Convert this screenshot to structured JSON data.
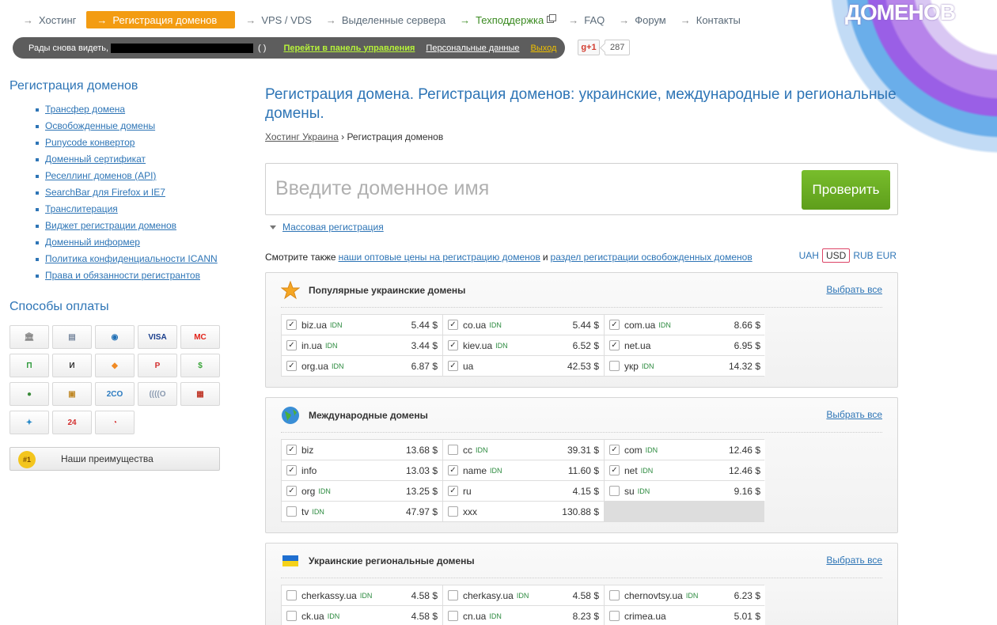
{
  "nav": [
    {
      "label": "Хостинг",
      "style": ""
    },
    {
      "label": "Регистрация доменов",
      "style": "active"
    },
    {
      "label": "VPS / VDS",
      "style": ""
    },
    {
      "label": "Выделенные сервера",
      "style": ""
    },
    {
      "label": "Техподдержка",
      "style": "green"
    },
    {
      "label": "FAQ",
      "style": ""
    },
    {
      "label": "Форум",
      "style": ""
    },
    {
      "label": "Контакты",
      "style": ""
    }
  ],
  "nav_arrow": "→",
  "brand": "ДОМЕНОВ",
  "greeting": {
    "text": "Рады снова видеть,",
    "paren": "( )",
    "panel_link": "Перейти в панель управления",
    "personal_link": "Персональные данные",
    "logout_link": "Выход"
  },
  "gplus": {
    "label": "g+1",
    "count": "287"
  },
  "sidebar": {
    "heading": "Регистрация доменов",
    "links": [
      "Трансфер домена",
      "Освобожденные домены",
      "Punycode конвертор",
      "Доменный сертификат",
      "Реселлинг доменов (API)",
      "SearchBar для Firefox и IE7",
      "Транслитерация",
      "Виджет регистрации доменов",
      "Доменный информер",
      "Политика конфиденциальности ICANN",
      "Права и обязанности регистрантов"
    ],
    "payments_heading": "Способы оплаты",
    "payment_methods": [
      {
        "icon": "bank-icon",
        "text": "🏛",
        "color": "#8a8a8a"
      },
      {
        "icon": "invoice-icon",
        "text": "▤",
        "color": "#7a8aa0"
      },
      {
        "icon": "webmoney-icon",
        "text": "◉",
        "color": "#1f6fb5"
      },
      {
        "icon": "visa-icon",
        "text": "VISA",
        "color": "#1a3e8c"
      },
      {
        "icon": "mastercard-icon",
        "text": "MC",
        "color": "#e2231a"
      },
      {
        "icon": "privatbank-icon",
        "text": "Π",
        "color": "#2d9a3a"
      },
      {
        "icon": "liqpay-icon",
        "text": "И",
        "color": "#333"
      },
      {
        "icon": "wallet-icon",
        "text": "◆",
        "color": "#f08a24"
      },
      {
        "icon": "paypal-icon",
        "text": "P",
        "color": "#d32f2f"
      },
      {
        "icon": "dollar-icon",
        "text": "$",
        "color": "#3aa53a"
      },
      {
        "icon": "terminal-icon",
        "text": "●",
        "color": "#3a8a3a"
      },
      {
        "icon": "safe-icon",
        "text": "▣",
        "color": "#c08a2a"
      },
      {
        "icon": "2co-icon",
        "text": "2CO",
        "color": "#2a7ac0"
      },
      {
        "icon": "rbk-icon",
        "text": "((((O",
        "color": "#8a9ab0"
      },
      {
        "icon": "cash-register-icon",
        "text": "▦",
        "color": "#c0392b"
      },
      {
        "icon": "runner-icon",
        "text": "✦",
        "color": "#2a8ac8"
      },
      {
        "icon": "24nonstop-icon",
        "text": "24",
        "color": "#d32f2f"
      },
      {
        "icon": "swirl-icon",
        "text": "◔",
        "color": "#d32f2f"
      }
    ],
    "advantages": {
      "medal": "#1",
      "label": "Наши преимущества"
    }
  },
  "main": {
    "title": "Регистрация домена. Регистрация доменов: украинские, международные и региональные домены.",
    "breadcrumb": {
      "home": "Хостинг Украина",
      "sep": "›",
      "current": "Регистрация доменов"
    },
    "search": {
      "placeholder": "Введите доменное имя",
      "button": "Проверить"
    },
    "mass_registration": "Массовая регистрация",
    "see_also": {
      "prefix": "Смотрите также",
      "link1": "наши оптовые цены на регистрацию доменов",
      "and": "и",
      "link2": "раздел регистрации освобожденных доменов"
    },
    "currencies": [
      "UAH",
      "USD",
      "RUB",
      "EUR"
    ],
    "selected_currency": "USD",
    "select_all": "Выбрать все",
    "idn_label": "IDN",
    "groups": [
      {
        "title": "Популярные украинские домены",
        "icon": "star-icon",
        "domains": [
          {
            "name": "biz.ua",
            "idn": true,
            "price": "5.44 $",
            "checked": true
          },
          {
            "name": "co.ua",
            "idn": true,
            "price": "5.44 $",
            "checked": true
          },
          {
            "name": "com.ua",
            "idn": true,
            "price": "8.66 $",
            "checked": true
          },
          {
            "name": "in.ua",
            "idn": true,
            "price": "3.44 $",
            "checked": true
          },
          {
            "name": "kiev.ua",
            "idn": true,
            "price": "6.52 $",
            "checked": true
          },
          {
            "name": "net.ua",
            "idn": false,
            "price": "6.95 $",
            "checked": true
          },
          {
            "name": "org.ua",
            "idn": true,
            "price": "6.87 $",
            "checked": true
          },
          {
            "name": "ua",
            "idn": false,
            "price": "42.53 $",
            "checked": true
          },
          {
            "name": "укр",
            "idn": true,
            "price": "14.32 $",
            "checked": false
          }
        ]
      },
      {
        "title": "Международные домены",
        "icon": "globe-icon",
        "domains": [
          {
            "name": "biz",
            "idn": false,
            "price": "13.68 $",
            "checked": true
          },
          {
            "name": "cc",
            "idn": true,
            "price": "39.31 $",
            "checked": false
          },
          {
            "name": "com",
            "idn": true,
            "price": "12.46 $",
            "checked": true
          },
          {
            "name": "info",
            "idn": false,
            "price": "13.03 $",
            "checked": true
          },
          {
            "name": "name",
            "idn": true,
            "price": "11.60 $",
            "checked": true
          },
          {
            "name": "net",
            "idn": true,
            "price": "12.46 $",
            "checked": true
          },
          {
            "name": "org",
            "idn": true,
            "price": "13.25 $",
            "checked": true
          },
          {
            "name": "ru",
            "idn": false,
            "price": "4.15 $",
            "checked": true
          },
          {
            "name": "su",
            "idn": true,
            "price": "9.16 $",
            "checked": false
          },
          {
            "name": "tv",
            "idn": true,
            "price": "47.97 $",
            "checked": false
          },
          {
            "name": "xxx",
            "idn": false,
            "price": "130.88 $",
            "checked": false
          }
        ]
      },
      {
        "title": "Украинские региональные домены",
        "icon": "ukraine-flag-icon",
        "domains": [
          {
            "name": "cherkassy.ua",
            "idn": true,
            "price": "4.58 $",
            "checked": false
          },
          {
            "name": "cherkasy.ua",
            "idn": true,
            "price": "4.58 $",
            "checked": false
          },
          {
            "name": "chernovtsy.ua",
            "idn": true,
            "price": "6.23 $",
            "checked": false
          },
          {
            "name": "ck.ua",
            "idn": true,
            "price": "4.58 $",
            "checked": false
          },
          {
            "name": "cn.ua",
            "idn": true,
            "price": "8.23 $",
            "checked": false
          },
          {
            "name": "crimea.ua",
            "idn": false,
            "price": "5.01 $",
            "checked": false
          }
        ]
      }
    ]
  }
}
